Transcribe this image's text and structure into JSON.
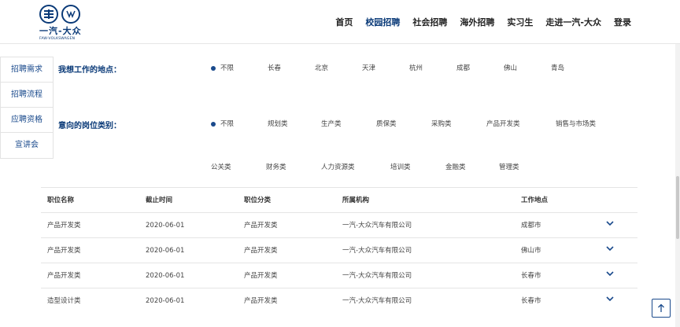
{
  "logo": {
    "cn": "一汽-大众",
    "en": "FAW-VOLKSWAGEN"
  },
  "nav": [
    "首页",
    "校园招聘",
    "社会招聘",
    "海外招聘",
    "实习生",
    "走进一汽-大众",
    "登录"
  ],
  "nav_active": "校园招聘",
  "sidebar": [
    "招聘需求",
    "招聘流程",
    "应聘资格",
    "宣讲会"
  ],
  "filters": {
    "location_label": "我想工作的地点：",
    "locations": [
      "不限",
      "长春",
      "北京",
      "天津",
      "杭州",
      "成都",
      "佛山",
      "青岛"
    ],
    "category_label": "意向的岗位类别：",
    "categories_row1": [
      "不限",
      "规划类",
      "生产类",
      "质保类",
      "采购类",
      "产品开发类",
      "销售与市场类"
    ],
    "categories_row2": [
      "公关类",
      "财务类",
      "人力资源类",
      "培训类",
      "金融类",
      "管理类"
    ],
    "selected": "不限"
  },
  "table": {
    "headers": [
      "职位名称",
      "截止时间",
      "职位分类",
      "所属机构",
      "工作地点"
    ],
    "rows": [
      [
        "产品开发类",
        "2020-06-01",
        "产品开发类",
        "一汽-大众汽车有限公司",
        "成都市"
      ],
      [
        "产品开发类",
        "2020-06-01",
        "产品开发类",
        "一汽-大众汽车有限公司",
        "佛山市"
      ],
      [
        "产品开发类",
        "2020-06-01",
        "产品开发类",
        "一汽-大众汽车有限公司",
        "长春市"
      ],
      [
        "造型设计类",
        "2020-06-01",
        "产品开发类",
        "一汽-大众汽车有限公司",
        "长春市"
      ]
    ]
  },
  "colors": {
    "brand": "#0a3a78",
    "link": "#1a4a8c"
  },
  "icons": {
    "expand": "chevron-down-icon",
    "back_to_top": "arrow-up-icon"
  }
}
